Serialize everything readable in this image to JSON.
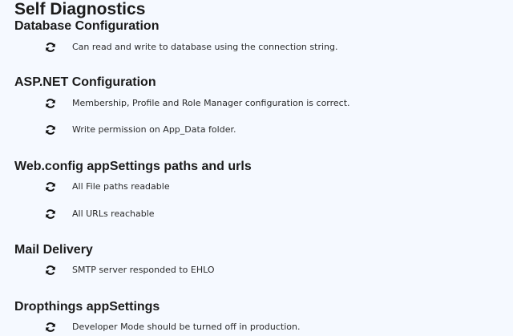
{
  "page": {
    "title": "Self Diagnostics"
  },
  "sections": [
    {
      "title": "Database Configuration",
      "checks": [
        {
          "icon": "refresh-icon",
          "text": "Can read and write to database using the connection string."
        }
      ]
    },
    {
      "title": "ASP.NET Configuration",
      "checks": [
        {
          "icon": "refresh-icon",
          "text": "Membership, Profile and Role Manager configuration is correct."
        },
        {
          "icon": "refresh-icon",
          "text": "Write permission on App_Data folder."
        }
      ]
    },
    {
      "title": "Web.config appSettings paths and urls",
      "checks": [
        {
          "icon": "refresh-icon",
          "text": "All File paths readable"
        },
        {
          "icon": "refresh-icon",
          "text": "All URLs reachable"
        }
      ]
    },
    {
      "title": "Mail Delivery",
      "checks": [
        {
          "icon": "refresh-icon",
          "text": "SMTP server responded to EHLO"
        }
      ]
    },
    {
      "title": "Dropthings appSettings",
      "checks": [
        {
          "icon": "refresh-icon",
          "text": "Developer Mode should be turned off in production."
        }
      ]
    }
  ],
  "colors": {
    "background": "#f5f9ff",
    "heading": "#1b1b1b",
    "text": "#2a2a2a",
    "icon": "#111111"
  }
}
